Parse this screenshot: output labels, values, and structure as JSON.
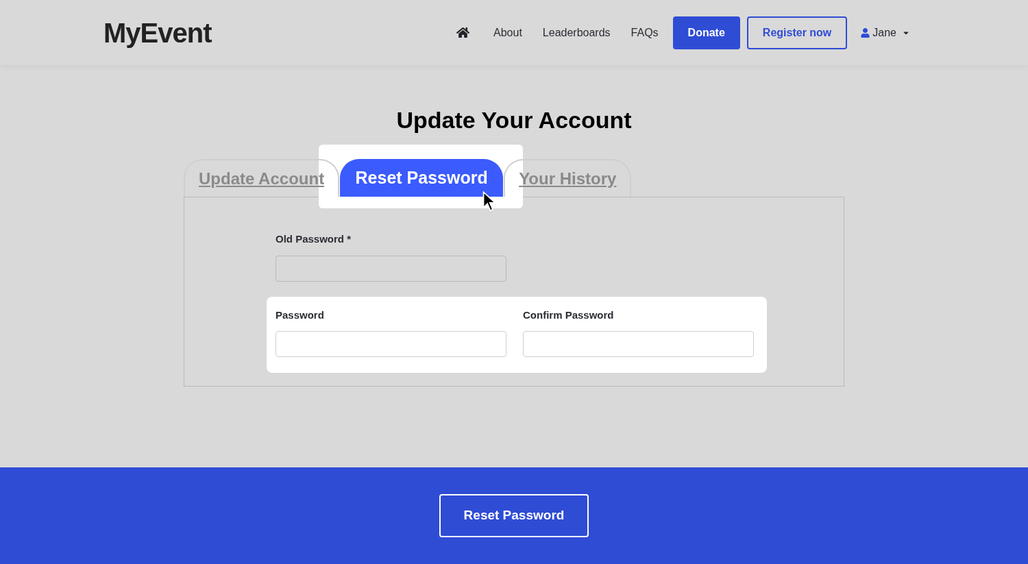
{
  "header": {
    "logo": "MyEvent",
    "nav": [
      {
        "kind": "home"
      },
      {
        "kind": "link",
        "label": "About"
      },
      {
        "kind": "link",
        "label": "Leaderboards"
      },
      {
        "kind": "link",
        "label": "FAQs"
      },
      {
        "kind": "primary",
        "label": "Donate"
      },
      {
        "kind": "outline",
        "label": "Register now"
      },
      {
        "kind": "user",
        "label": "Jane"
      }
    ]
  },
  "title": "Update Your Account",
  "tabs": [
    {
      "label": "Update Account",
      "selected": false
    },
    {
      "label": "Reset Password",
      "selected": true
    },
    {
      "label": "Your History",
      "selected": false
    }
  ],
  "field_groups": [
    {
      "highlighted": false,
      "fields": [
        {
          "label": "Old Password *"
        }
      ]
    },
    {
      "highlighted": true,
      "fields": [
        {
          "label": "Password"
        },
        {
          "label": "Confirm Password"
        }
      ]
    }
  ],
  "footer": {
    "button": "Reset Password"
  }
}
